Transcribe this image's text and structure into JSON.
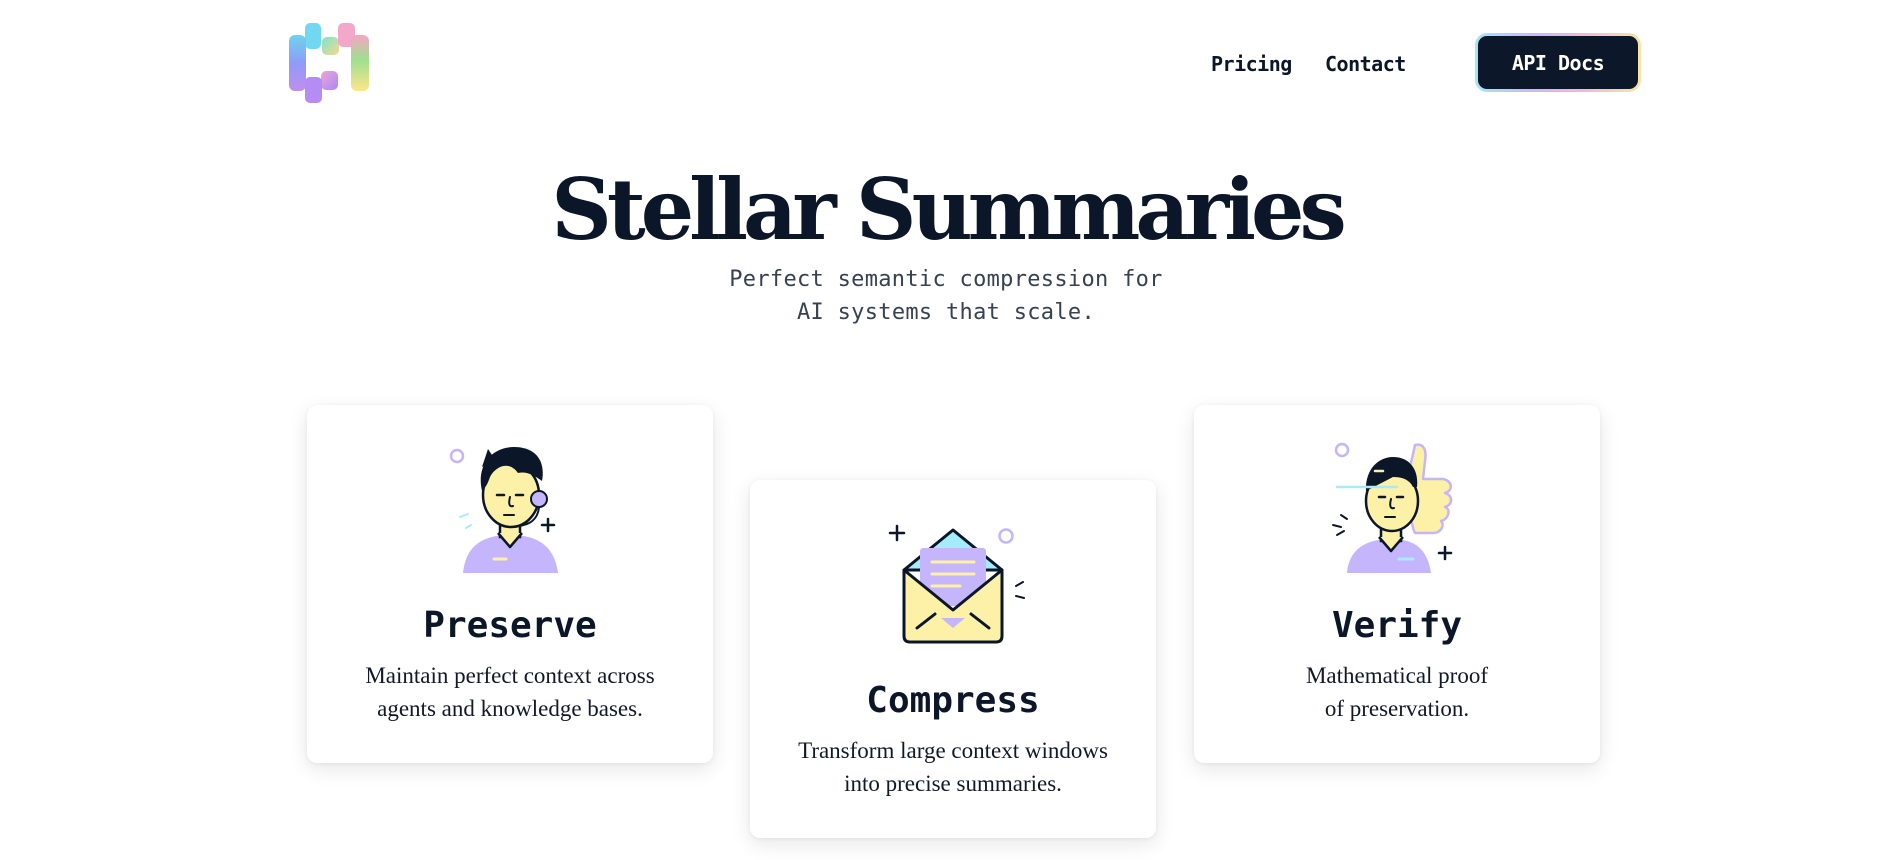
{
  "brand": {
    "logo_icon": "gradient-h-logo-icon",
    "gradient_colors": [
      "#6ed3f0",
      "#a78bfa",
      "#f472b6",
      "#fde68a"
    ]
  },
  "nav": {
    "pricing": "Pricing",
    "contact": "Contact",
    "api_docs": "API Docs"
  },
  "hero": {
    "title": "Stellar Summaries",
    "subtitle_lines": [
      "Perfect semantic compression for",
      "AI systems that scale."
    ]
  },
  "features": [
    {
      "icon": "person-headset-icon",
      "title": "Preserve",
      "lines": [
        "Maintain perfect context across",
        "agents and knowledge bases."
      ]
    },
    {
      "icon": "open-envelope-icon",
      "title": "Compress",
      "lines": [
        "Transform large context windows",
        "into precise summaries."
      ]
    },
    {
      "icon": "person-thumbs-up-icon",
      "title": "Verify",
      "lines": [
        "Mathematical proof",
        "of preservation."
      ]
    }
  ],
  "colors": {
    "ink": "#0b1628",
    "lavender": "#c4b5fd",
    "pale_yellow": "#fdf1a8",
    "sky": "#a5ecfa",
    "api_button_bg": "#0c1829"
  }
}
